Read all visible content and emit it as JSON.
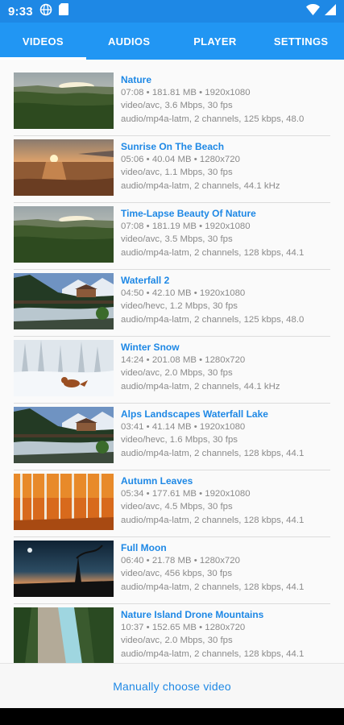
{
  "status_bar": {
    "time": "9:33",
    "icons_left": [
      "globe-icon",
      "sim-card-icon"
    ],
    "icons_right": [
      "wifi-icon",
      "cell-signal-icon"
    ]
  },
  "tabs": [
    {
      "label": "VIDEOS",
      "active": true
    },
    {
      "label": "AUDIOS",
      "active": false
    },
    {
      "label": "PLAYER",
      "active": false
    },
    {
      "label": "SETTINGS",
      "active": false
    }
  ],
  "videos": [
    {
      "title": "Nature",
      "line1": "07:08 • 181.81 MB • 1920x1080",
      "line2": "video/avc, 3.6 Mbps, 30 fps",
      "line3": "audio/mp4a-latm, 2 channels, 125 kbps, 48.0",
      "thumb": "valley-sunset"
    },
    {
      "title": "Sunrise On The Beach",
      "line1": "05:06 • 40.04 MB • 1280x720",
      "line2": "video/avc, 1.1 Mbps, 30 fps",
      "line3": "audio/mp4a-latm, 2 channels, 44.1 kHz",
      "thumb": "beach-sunrise"
    },
    {
      "title": "Time-Lapse Beauty Of Nature",
      "line1": "07:08 • 181.19 MB • 1920x1080",
      "line2": "video/avc, 3.5 Mbps, 30 fps",
      "line3": "audio/mp4a-latm, 2 channels, 128 kbps, 44.1",
      "thumb": "valley-sunset"
    },
    {
      "title": "Waterfall 2",
      "line1": "04:50 • 42.10 MB • 1920x1080",
      "line2": "video/hevc, 1.2 Mbps, 30 fps",
      "line3": "audio/mp4a-latm, 2 channels, 125 kbps, 48.0",
      "thumb": "alpine-river"
    },
    {
      "title": "Winter Snow",
      "line1": "14:24 • 201.08 MB • 1280x720",
      "line2": "video/avc, 2.0 Mbps, 30 fps",
      "line3": "audio/mp4a-latm, 2 channels, 44.1 kHz",
      "thumb": "winter-fox"
    },
    {
      "title": "Alps Landscapes Waterfall Lake",
      "line1": "03:41 • 41.14 MB • 1920x1080",
      "line2": "video/hevc, 1.6 Mbps, 30 fps",
      "line3": "audio/mp4a-latm, 2 channels, 128 kbps, 44.1",
      "thumb": "alpine-river"
    },
    {
      "title": "Autumn Leaves",
      "line1": "05:34 • 177.61 MB • 1920x1080",
      "line2": "video/avc, 4.5 Mbps, 30 fps",
      "line3": "audio/mp4a-latm, 2 channels, 128 kbps, 44.1",
      "thumb": "autumn-forest"
    },
    {
      "title": "Full Moon",
      "line1": "06:40 • 21.78 MB • 1280x720",
      "line2": "video/avc, 456 kbps, 30 fps",
      "line3": "audio/mp4a-latm, 2 channels, 128 kbps, 44.1",
      "thumb": "full-moon"
    },
    {
      "title": "Nature Island Drone Mountains",
      "line1": "10:37 • 152.65 MB • 1280x720",
      "line2": "video/avc, 2.0 Mbps, 30 fps",
      "line3": "audio/mp4a-latm, 2 channels, 128 kbps, 44.1",
      "thumb": "drone-river"
    }
  ],
  "footer": {
    "button_label": "Manually choose video"
  },
  "colors": {
    "accent": "#2196f3",
    "status_bar": "#1e88e5",
    "title_text": "#1e88e5",
    "meta_text": "#8a8a8a"
  }
}
